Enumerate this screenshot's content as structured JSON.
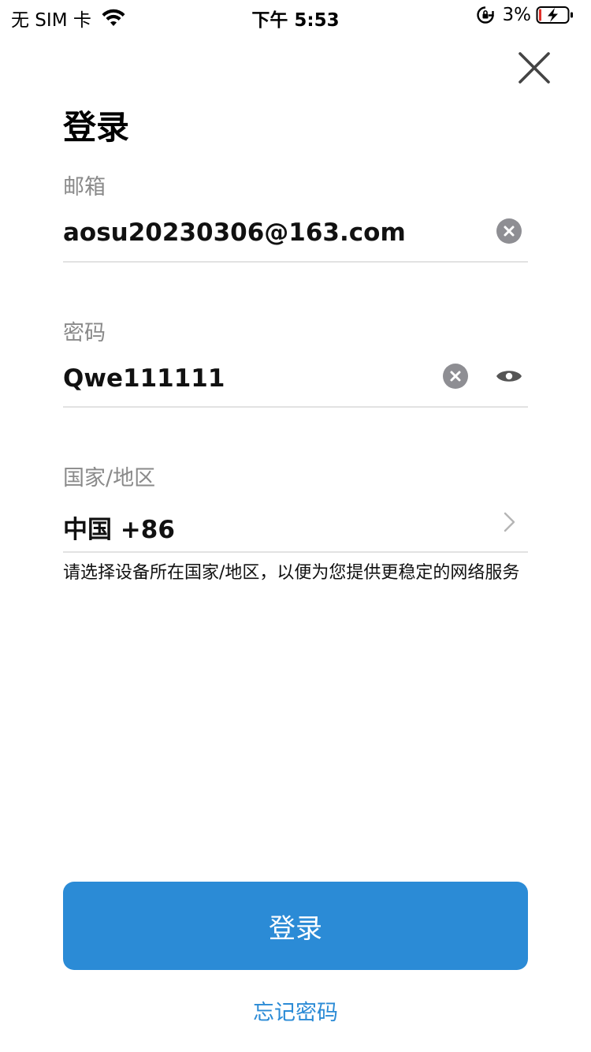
{
  "status_bar": {
    "carrier": "无 SIM 卡",
    "time": "下午 5:53",
    "battery": "3%",
    "icons": [
      "wifi-icon",
      "orientation-lock-icon",
      "battery-charging-icon"
    ]
  },
  "header": {
    "title": "登录",
    "close_icon": "close-icon"
  },
  "form": {
    "email": {
      "label": "邮箱",
      "value": "aosu20230306@163.com",
      "clear_icon": "clear-icon"
    },
    "password": {
      "label": "密码",
      "value": "Qwe111111",
      "clear_icon": "clear-icon",
      "visibility_icon": "eye-icon"
    },
    "country": {
      "label": "国家/地区",
      "value": "中国 +86",
      "chevron_icon": "chevron-right-icon"
    },
    "hint": "请选择设备所在国家/地区，以便为您提供更稳定的网络服务"
  },
  "actions": {
    "login_label": "登录",
    "forgot_password_label": "忘记密码"
  },
  "colors": {
    "accent": "#2b8bd6",
    "label_gray": "#8a8a8a",
    "divider": "#e2e2e2",
    "icon_gray": "#8e8e93"
  }
}
